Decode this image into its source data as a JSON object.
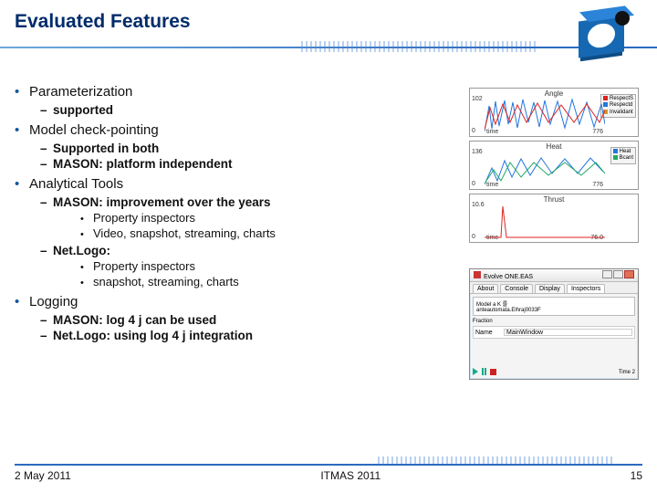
{
  "title": "Evaluated Features",
  "bullets": {
    "param": {
      "label": "Parameterization",
      "sub1": "supported"
    },
    "checkpoint": {
      "label": "Model check-pointing",
      "sub1": "Supported in both",
      "sub2": "MASON: platform independent"
    },
    "tools": {
      "label": "Analytical Tools",
      "mason": {
        "label": "MASON: improvement over the years",
        "s1": "Property inspectors",
        "s2": "Video, snapshot, streaming, charts"
      },
      "netlogo": {
        "label": "Net.Logo:",
        "s1": "Property inspectors",
        "s2": "snapshot, streaming, charts"
      }
    },
    "logging": {
      "label": "Logging",
      "sub1": "MASON: log 4 j can be used",
      "sub2": "Net.Logo: using log 4 j integration"
    }
  },
  "charts": {
    "c1": {
      "title": "Angle",
      "yhi": "102",
      "ylo": "0",
      "xlo": "time",
      "xhi": "776",
      "legend": [
        "RespectS",
        "Respectd",
        "Invalidant"
      ]
    },
    "c2": {
      "title": "Heat",
      "yhi": "136",
      "ylo": "0",
      "xlo": "time",
      "xhi": "776",
      "legend": [
        "Heat",
        "Bcant"
      ]
    },
    "c3": {
      "title": "Thrust",
      "yhi": "10.6",
      "ylo": "0",
      "xlo": "time",
      "xhi": "76.0",
      "legend": []
    }
  },
  "window": {
    "title": "Evolve ONE.EAS",
    "tabs": [
      "About",
      "Console",
      "Display",
      "Inspectors"
    ],
    "model_label": "Model a K 를",
    "model_sub": "anteautomata.Elhraj0033F",
    "section": "Fraction",
    "field1_label": "Name",
    "field1_value": "MainWindow",
    "time_label": "Time",
    "time_value": "2"
  },
  "footer": {
    "date": "2 May 2011",
    "conf": "ITMAS 2011",
    "page": "15"
  }
}
